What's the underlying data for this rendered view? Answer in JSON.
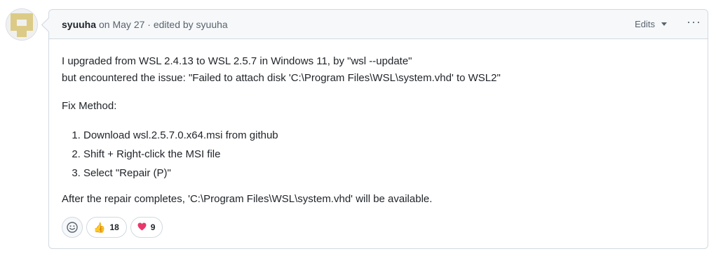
{
  "comment": {
    "author": "syuuha",
    "meta": "on May 27 · edited by syuuha",
    "edits_label": "Edits",
    "more_label": "···",
    "body": {
      "line1": "I upgraded from WSL 2.4.13 to WSL 2.5.7 in Windows 11, by \"wsl --update\"",
      "line2": "but encountered the issue: \"Failed to attach disk 'C:\\Program Files\\WSL\\system.vhd' to WSL2\"",
      "fix_heading": "Fix Method:",
      "steps": [
        "Download wsl.2.5.7.0.x64.msi from github",
        "Shift + Right-click the MSI file",
        "Select \"Repair (P)\""
      ],
      "closing": "After the repair completes, 'C:\\Program Files\\WSL\\system.vhd' will be available."
    },
    "reactions": [
      {
        "emoji": "👍",
        "icon": "thumbs-up-icon",
        "count": "18"
      },
      {
        "emoji": "❤️",
        "icon": "heart-icon",
        "count": "9"
      }
    ]
  },
  "colors": {
    "avatar_primary": "#dccb86",
    "border": "#d1d9e0",
    "header_bg": "#f6f8fa",
    "heart": "#e8376b"
  }
}
